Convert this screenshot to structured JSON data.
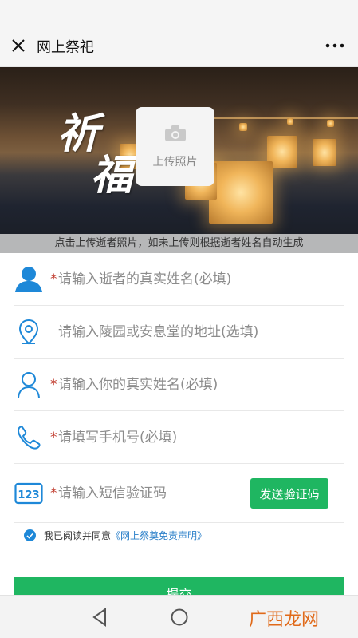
{
  "header": {
    "title": "网上祭祀",
    "close_icon": "close-icon",
    "more_icon": "more-icon"
  },
  "banner": {
    "calligraphy": "祈福",
    "upload_label": "上传照片",
    "hint": "点击上传逝者照片，如未上传则根据逝者姓名自动生成"
  },
  "form": {
    "fields": [
      {
        "icon": "person-icon",
        "required": true,
        "placeholder": "请输入逝者的真实姓名(必填)"
      },
      {
        "icon": "location-pin-icon",
        "required": false,
        "placeholder": "请输入陵园或安息堂的地址(选填)"
      },
      {
        "icon": "user-outline-icon",
        "required": true,
        "placeholder": "请输入你的真实姓名(必填)"
      },
      {
        "icon": "phone-icon",
        "required": true,
        "placeholder": "请填写手机号(必填)"
      },
      {
        "icon": "numeric-code-icon",
        "required": true,
        "placeholder": "请输入短信验证码"
      }
    ],
    "required_mark": "*",
    "send_code_label": "发送验证码",
    "agree_text": "我已阅读并同意",
    "agree_link": "《网上祭奠免责声明》",
    "submit_label": "提交"
  },
  "watermark": "广西龙网",
  "colors": {
    "accent_green": "#1fb661",
    "required_red": "#c0392b",
    "link_blue": "#2a7fc9",
    "icon_blue": "#1e88d8"
  }
}
